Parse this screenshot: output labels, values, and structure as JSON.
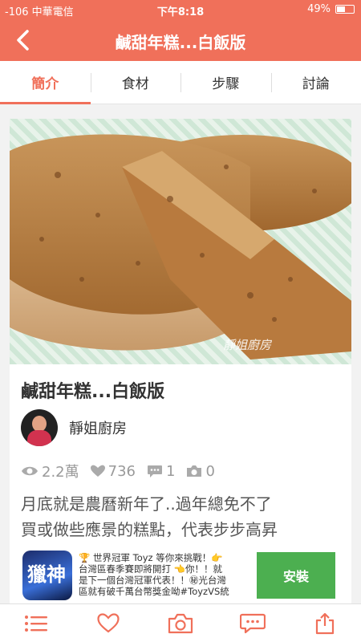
{
  "status_bar": {
    "signal": "-106 中華電信",
    "time": "下午8:18",
    "battery": "49%",
    "battery_level": 0.49
  },
  "nav": {
    "title": "鹹甜年糕...白飯版"
  },
  "tabs": [
    {
      "label": "簡介",
      "active": true
    },
    {
      "label": "食材",
      "active": false
    },
    {
      "label": "步驟",
      "active": false
    },
    {
      "label": "討論",
      "active": false
    }
  ],
  "recipe": {
    "photo_watermark": "靜姐廚房",
    "title": "鹹甜年糕...白飯版",
    "author": "靜姐廚房",
    "stats": {
      "views": "2.2萬",
      "likes": "736",
      "comments": "1",
      "photos": "0"
    },
    "description_lines": [
      "月底就是農曆新年了..過年總免不了",
      "買或做些應景的糕點，代表步步高昇"
    ]
  },
  "ad": {
    "icon_text": "獵神",
    "lines": [
      "🏆 世界冠軍 Toyz 等你來挑戰！👉",
      "台灣區春季賽即將開打 👈你！！就",
      "是下一個台灣冠軍代表！！㊙光台灣",
      "區就有破千萬台幣獎金呦#ToyzVS統"
    ],
    "button": "安裝"
  },
  "colors": {
    "accent": "#f0705a",
    "install_green": "#4caf50"
  }
}
